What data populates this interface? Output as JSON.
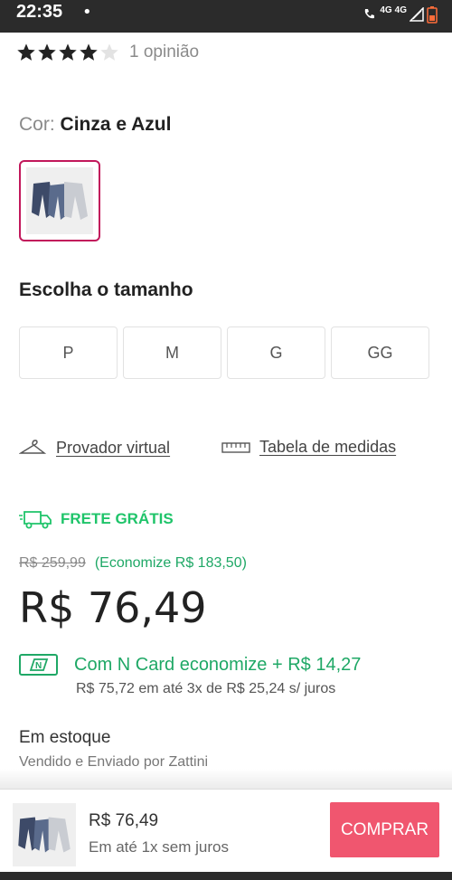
{
  "status_bar": {
    "time": "22:35",
    "dot": "•",
    "network": "4G",
    "network2": "4G"
  },
  "rating": {
    "stars": 4,
    "max_stars": 5,
    "count_label": "1 opinião"
  },
  "color": {
    "label": "Cor:",
    "value": "Cinza e Azul"
  },
  "size": {
    "title": "Escolha o tamanho",
    "options": [
      "P",
      "M",
      "G",
      "GG"
    ]
  },
  "links": {
    "fitting_room": "Provador virtual",
    "size_chart": "Tabela de medidas"
  },
  "shipping": {
    "label": "FRETE GRÁTIS"
  },
  "pricing": {
    "old_price": "R$ 259,99",
    "savings": "(Economize R$ 183,50)",
    "price": "R$ 76,49",
    "ncard_text": "Com N Card economize + R$ 14,27",
    "installments": "R$ 75,72 em até 3x de R$ 25,24 s/ juros"
  },
  "stock": {
    "status": "Em estoque",
    "seller": "Vendido e Enviado por Zattini"
  },
  "bottom_bar": {
    "price": "R$ 76,49",
    "terms": "Em até 1x sem juros",
    "buy_label": "COMPRAR"
  },
  "colors": {
    "accent": "#c2185b",
    "green": "#1fa866",
    "buy": "#f0566f",
    "star": "#222222"
  }
}
